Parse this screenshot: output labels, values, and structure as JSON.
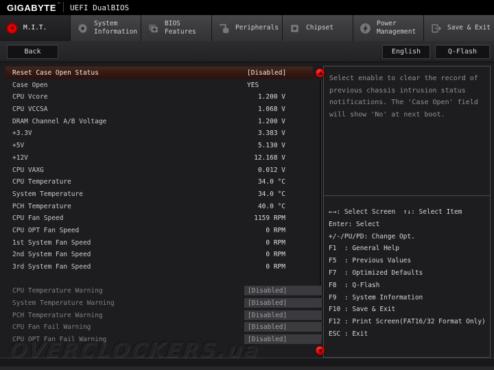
{
  "brand": {
    "logo": "GIGABYTE",
    "tm": "™",
    "title": "UEFI DualBIOS"
  },
  "accent": {
    "red": "#e00000",
    "selected_row": "#3a1f15",
    "panel_border": "#49494c"
  },
  "tabs": [
    {
      "id": "mit",
      "label": "M.I.T.",
      "icon": "dial",
      "active": true
    },
    {
      "id": "system-information",
      "label": "System\nInformation",
      "icon": "gear",
      "active": false
    },
    {
      "id": "bios-features",
      "label": "BIOS\nFeatures",
      "icon": "chip-plus",
      "active": false
    },
    {
      "id": "peripherals",
      "label": "Peripherals",
      "icon": "mouse",
      "active": false
    },
    {
      "id": "chipset",
      "label": "Chipset",
      "icon": "chipset",
      "active": false
    },
    {
      "id": "power-management",
      "label": "Power\nManagement",
      "icon": "lightning",
      "active": false
    },
    {
      "id": "save-exit",
      "label": "Save & Exit",
      "icon": "exit",
      "active": false
    }
  ],
  "toolbar": {
    "back": "Back",
    "language": "English",
    "qflash": "Q-Flash"
  },
  "settings_list": {
    "rows": [
      {
        "label": "Reset Case Open Status",
        "value": "[Disabled]",
        "type": "option",
        "state": "selected"
      },
      {
        "label": "Case Open",
        "value": "YES",
        "type": "text",
        "state": "normal"
      },
      {
        "label": "CPU Vcore",
        "value": "1.200 V",
        "type": "num",
        "state": "normal"
      },
      {
        "label": "CPU VCCSA",
        "value": "1.068 V",
        "type": "num",
        "state": "normal"
      },
      {
        "label": "DRAM Channel A/B Voltage",
        "value": "1.200 V",
        "type": "num",
        "state": "normal"
      },
      {
        "label": "+3.3V",
        "value": "3.383 V",
        "type": "num",
        "state": "normal"
      },
      {
        "label": "+5V",
        "value": "5.130 V",
        "type": "num",
        "state": "normal"
      },
      {
        "label": "+12V",
        "value": "12.168 V",
        "type": "num",
        "state": "normal"
      },
      {
        "label": "CPU VAXG",
        "value": "0.012 V",
        "type": "num",
        "state": "normal"
      },
      {
        "label": "CPU Temperature",
        "value": "34.0 °C",
        "type": "num",
        "state": "normal"
      },
      {
        "label": "System Temperature",
        "value": "34.0 °C",
        "type": "num",
        "state": "normal"
      },
      {
        "label": "PCH Temperature",
        "value": "40.0 °C",
        "type": "num",
        "state": "normal"
      },
      {
        "label": "CPU Fan Speed",
        "value": "1159 RPM",
        "type": "num",
        "state": "normal"
      },
      {
        "label": "CPU OPT Fan Speed",
        "value": "0 RPM",
        "type": "num",
        "state": "normal"
      },
      {
        "label": "1st System Fan Speed",
        "value": "0 RPM",
        "type": "num",
        "state": "normal"
      },
      {
        "label": "2nd System Fan Speed",
        "value": "0 RPM",
        "type": "num",
        "state": "normal"
      },
      {
        "label": "3rd System Fan Speed",
        "value": "0 RPM",
        "type": "num",
        "state": "normal"
      },
      {
        "spacer": true
      },
      {
        "label": "CPU Temperature Warning",
        "value": "[Disabled]",
        "type": "option",
        "state": "disabled"
      },
      {
        "label": "System Temperature Warning",
        "value": "[Disabled]",
        "type": "option",
        "state": "disabled"
      },
      {
        "label": "PCH Temperature Warning",
        "value": "[Disabled]",
        "type": "option",
        "state": "disabled"
      },
      {
        "label": "CPU Fan Fail Warning",
        "value": "[Disabled]",
        "type": "option",
        "state": "disabled"
      },
      {
        "label": "CPU OPT Fan Fail Warning",
        "value": "[Disabled]",
        "type": "option",
        "state": "disabled"
      }
    ]
  },
  "help_panel": {
    "text": "Select enable to clear the record of previous chassis intrusion status notifications. The 'Case Open' field will show 'No' at next boot."
  },
  "keys_panel": {
    "lines": [
      "←→: Select Screen  ↑↓: Select Item",
      "Enter: Select",
      "+/-/PU/PD: Change Opt.",
      "F1  : General Help",
      "F5  : Previous Values",
      "F7  : Optimized Defaults",
      "F8  : Q-Flash",
      "F9  : System Information",
      "F10 : Save & Exit",
      "F12 : Print Screen(FAT16/32 Format Only)",
      "ESC : Exit"
    ]
  },
  "watermark": "OVERCLOCKERS.ua"
}
